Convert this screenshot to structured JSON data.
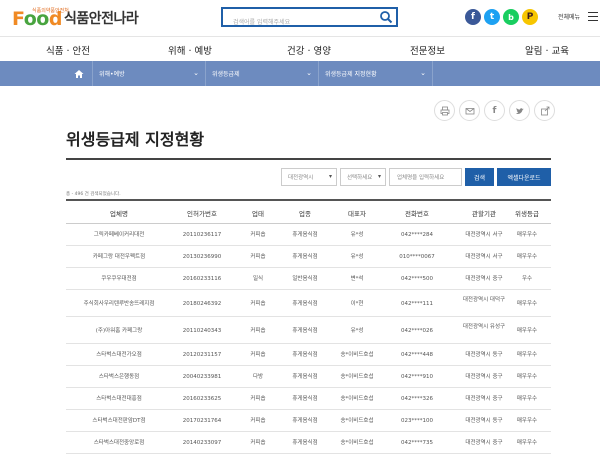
{
  "header": {
    "logo_small": "식품의약품안전처",
    "logo_food": "F",
    "logo_oo": "oo",
    "logo_d": "d",
    "logo_title": "식품안전나라",
    "search_placeholder": "검색어를 입력해주세요",
    "all_menu": "전체메뉴"
  },
  "nav": [
    "식품 · 안전",
    "위해 · 예방",
    "건강 · 영양",
    "전문정보",
    "알림 · 교육"
  ],
  "breadcrumb": [
    "위해•예방",
    "위생등급제",
    "위생등급제 지정현황"
  ],
  "page_title": "위생등급제 지정현황",
  "filters": {
    "region": "대전광역시",
    "district": "선택하세요",
    "name_placeholder": "업체명을 입력하세요",
    "search_btn": "검색",
    "excel_btn": "엑셀다운로드"
  },
  "total_text": "총 - 496 건 검색되었습니다.",
  "table": {
    "headers": [
      "업체명",
      "인허가번호",
      "업태",
      "업종",
      "대표자",
      "전화번호",
      "관할기관",
      "위생등급"
    ],
    "rows": [
      [
        "그릭카페베이커리대전",
        "20110236117",
        "커피숍",
        "휴게음식점",
        "유*성",
        "042****284",
        "대전광역시 서구",
        "매우우수"
      ],
      [
        "카페그랑 대전우펙트점",
        "20130236990",
        "커피숍",
        "휴게음식점",
        "유*성",
        "010****0067",
        "대전광역시 서구",
        "매우우수"
      ],
      [
        "쿠우쿠우대전점",
        "20160233116",
        "일식",
        "일반음식점",
        "변*석",
        "042****500",
        "대전광역시 중구",
        "우수"
      ],
      [
        "주식회사우리텐루반송뜨레지점",
        "20180246392",
        "커피숍",
        "휴게음식점",
        "이*현",
        "042****111",
        "대전광역시 대덕구",
        "매우우수"
      ],
      [
        "(주)아워홈 카페그랑",
        "20110240343",
        "커피숍",
        "휴게음식점",
        "유*성",
        "042****026",
        "대전광역시 유성구",
        "매우우수"
      ],
      [
        "스타벅스대전가오점",
        "20120231157",
        "커피숍",
        "휴게음식점",
        "송*이비드호섭",
        "042****448",
        "대전광역시 동구",
        "매우우수"
      ],
      [
        "스타벅스은행동점",
        "20040233981",
        "다방",
        "휴게음식점",
        "송*이비드호섭",
        "042****910",
        "대전광역시 중구",
        "매우우수"
      ],
      [
        "스타벅스대전대흥점",
        "20160233625",
        "커피숍",
        "휴게음식점",
        "송*이비드호섭",
        "042****326",
        "대전광역시 중구",
        "매우우수"
      ],
      [
        "스타벅스대전판암DT점",
        "20170231764",
        "커피숍",
        "휴게음식점",
        "송*이비드호섭",
        "023****100",
        "대전광역시 동구",
        "매우우수"
      ],
      [
        "스타벅스대전중앙로점",
        "20140233097",
        "커피숍",
        "휴게음식점",
        "송*이비드호섭",
        "042****735",
        "대전광역시 중구",
        "매우우수"
      ]
    ]
  }
}
